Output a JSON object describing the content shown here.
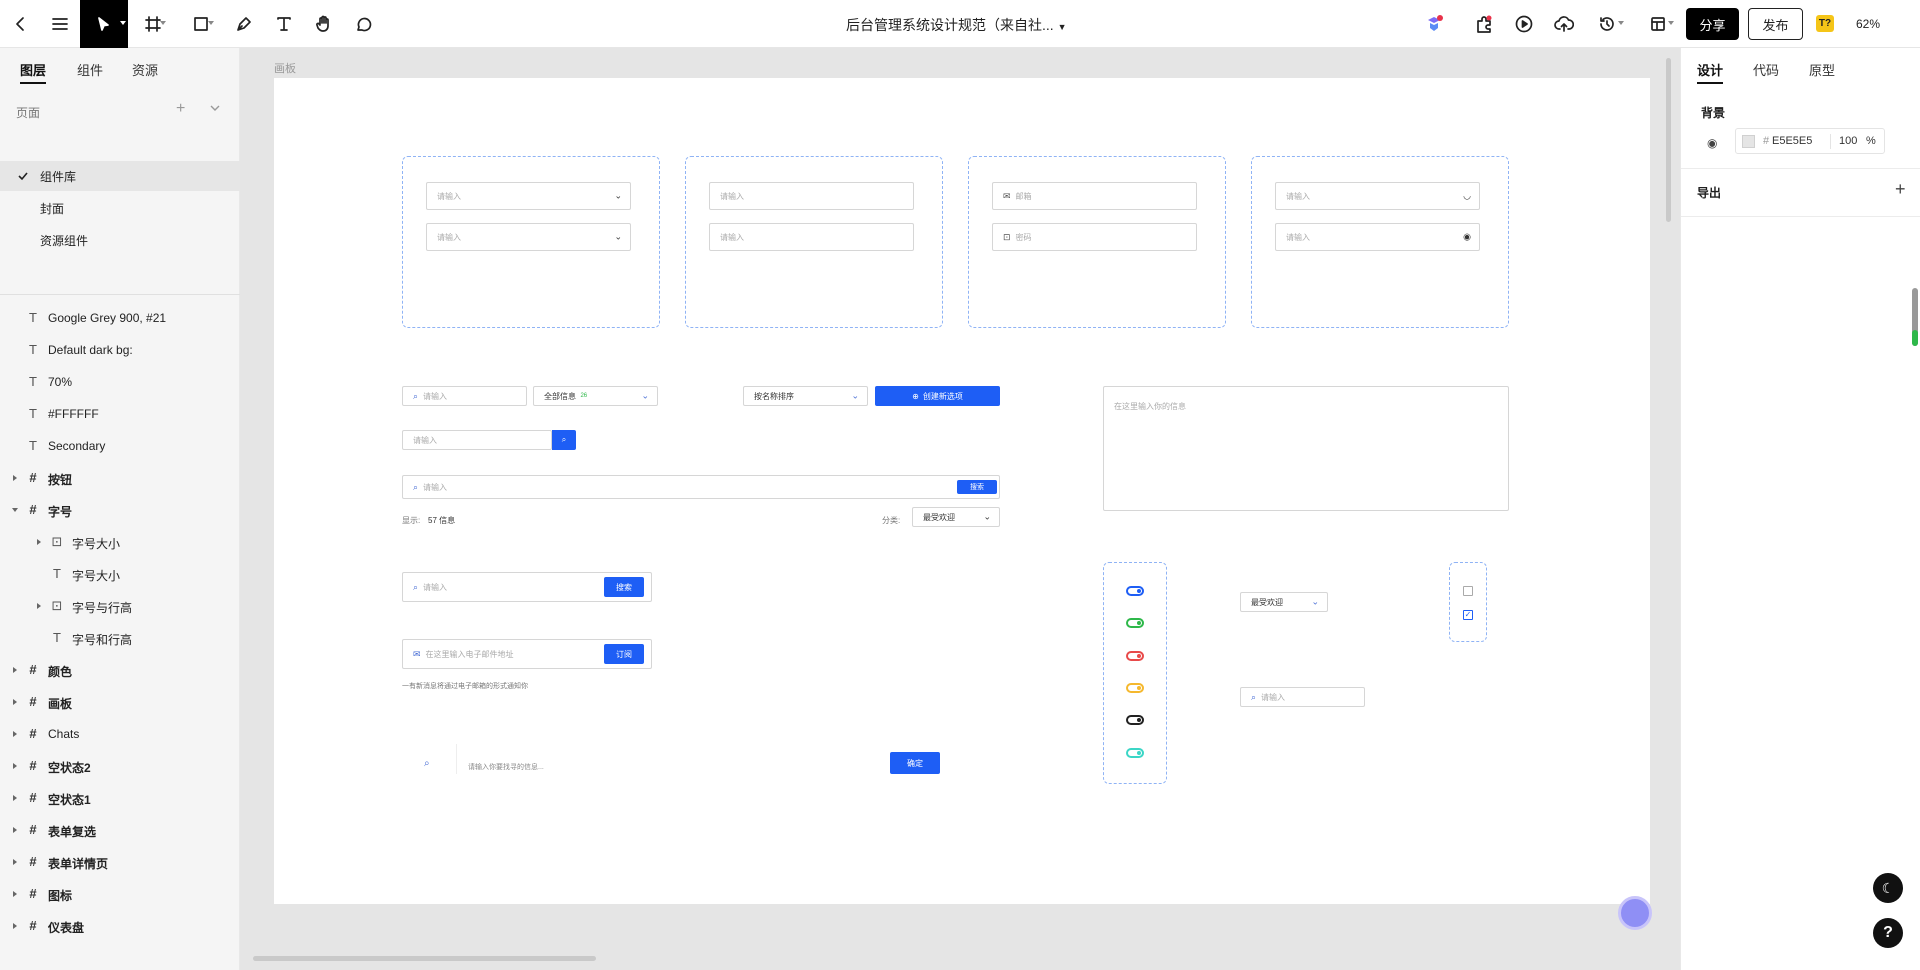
{
  "topbar": {
    "doc_title": "后台管理系统设计规范（来自社...",
    "share_label": "分享",
    "publish_label": "发布",
    "badge_label": "T?",
    "zoom": "62%"
  },
  "left_panel": {
    "tabs": [
      "图层",
      "组件",
      "资源"
    ],
    "pages_header": "页面",
    "pages": [
      "组件库",
      "封面",
      "资源组件"
    ],
    "layers": [
      {
        "type": "text",
        "label": "Google Grey 900, #21",
        "bold": false
      },
      {
        "type": "text",
        "label": "Default dark bg:",
        "bold": false
      },
      {
        "type": "text",
        "label": "70%",
        "bold": false
      },
      {
        "type": "text",
        "label": "#FFFFFF",
        "bold": false
      },
      {
        "type": "text",
        "label": "Secondary",
        "bold": false
      },
      {
        "type": "frame",
        "label": "按钮",
        "bold": true
      },
      {
        "type": "frame",
        "label": "字号",
        "bold": true
      },
      {
        "type": "component",
        "label": "字号大小",
        "bold": false
      },
      {
        "type": "text",
        "label": "字号大小",
        "bold": false
      },
      {
        "type": "component",
        "label": "字号与行高",
        "bold": false
      },
      {
        "type": "text",
        "label": "字号和行高",
        "bold": false
      },
      {
        "type": "frame",
        "label": "颜色",
        "bold": true
      },
      {
        "type": "frame",
        "label": "画板",
        "bold": true
      },
      {
        "type": "frame",
        "label": "Chats",
        "bold": false
      },
      {
        "type": "frame",
        "label": "空状态2",
        "bold": true
      },
      {
        "type": "frame",
        "label": "空状态1",
        "bold": true
      },
      {
        "type": "frame",
        "label": "表单复选",
        "bold": true
      },
      {
        "type": "frame",
        "label": "表单详情页",
        "bold": true
      },
      {
        "type": "frame",
        "label": "图标",
        "bold": true
      },
      {
        "type": "frame",
        "label": "仪表盘",
        "bold": true
      }
    ]
  },
  "canvas": {
    "board_label": "画板",
    "inputs": {
      "placeholder": "请输入",
      "email": "邮箱",
      "password": "密码",
      "all_info": "全部信息",
      "all_info_badge": "26",
      "sort_by_name": "按名称排序",
      "create_new": "创建新选项",
      "search_btn": "搜索",
      "show_label": "显示:",
      "show_count": "57 信息",
      "category_label": "分类:",
      "most_popular": "最受欢迎",
      "email_subscribe_placeholder": "在这里输入电子邮件地址",
      "subscribe_btn": "订阅",
      "subscribe_note": "一有新消息将通过电子邮箱的形式通知你",
      "search_long_placeholder": "请输入你要找寻的信息...",
      "confirm_btn": "确定",
      "textarea_placeholder": "在这里输入你的信息"
    },
    "toggle_colors": [
      "#1e5ef5",
      "#2eb84a",
      "#e84a4a",
      "#f5b82e",
      "#222222",
      "#3bd6c6"
    ]
  },
  "right_panel": {
    "tabs": [
      "设计",
      "代码",
      "原型"
    ],
    "background_label": "背景",
    "bg_hex": "E5E5E5",
    "bg_opacity": "100",
    "bg_opacity_unit": "%",
    "export_label": "导出"
  }
}
